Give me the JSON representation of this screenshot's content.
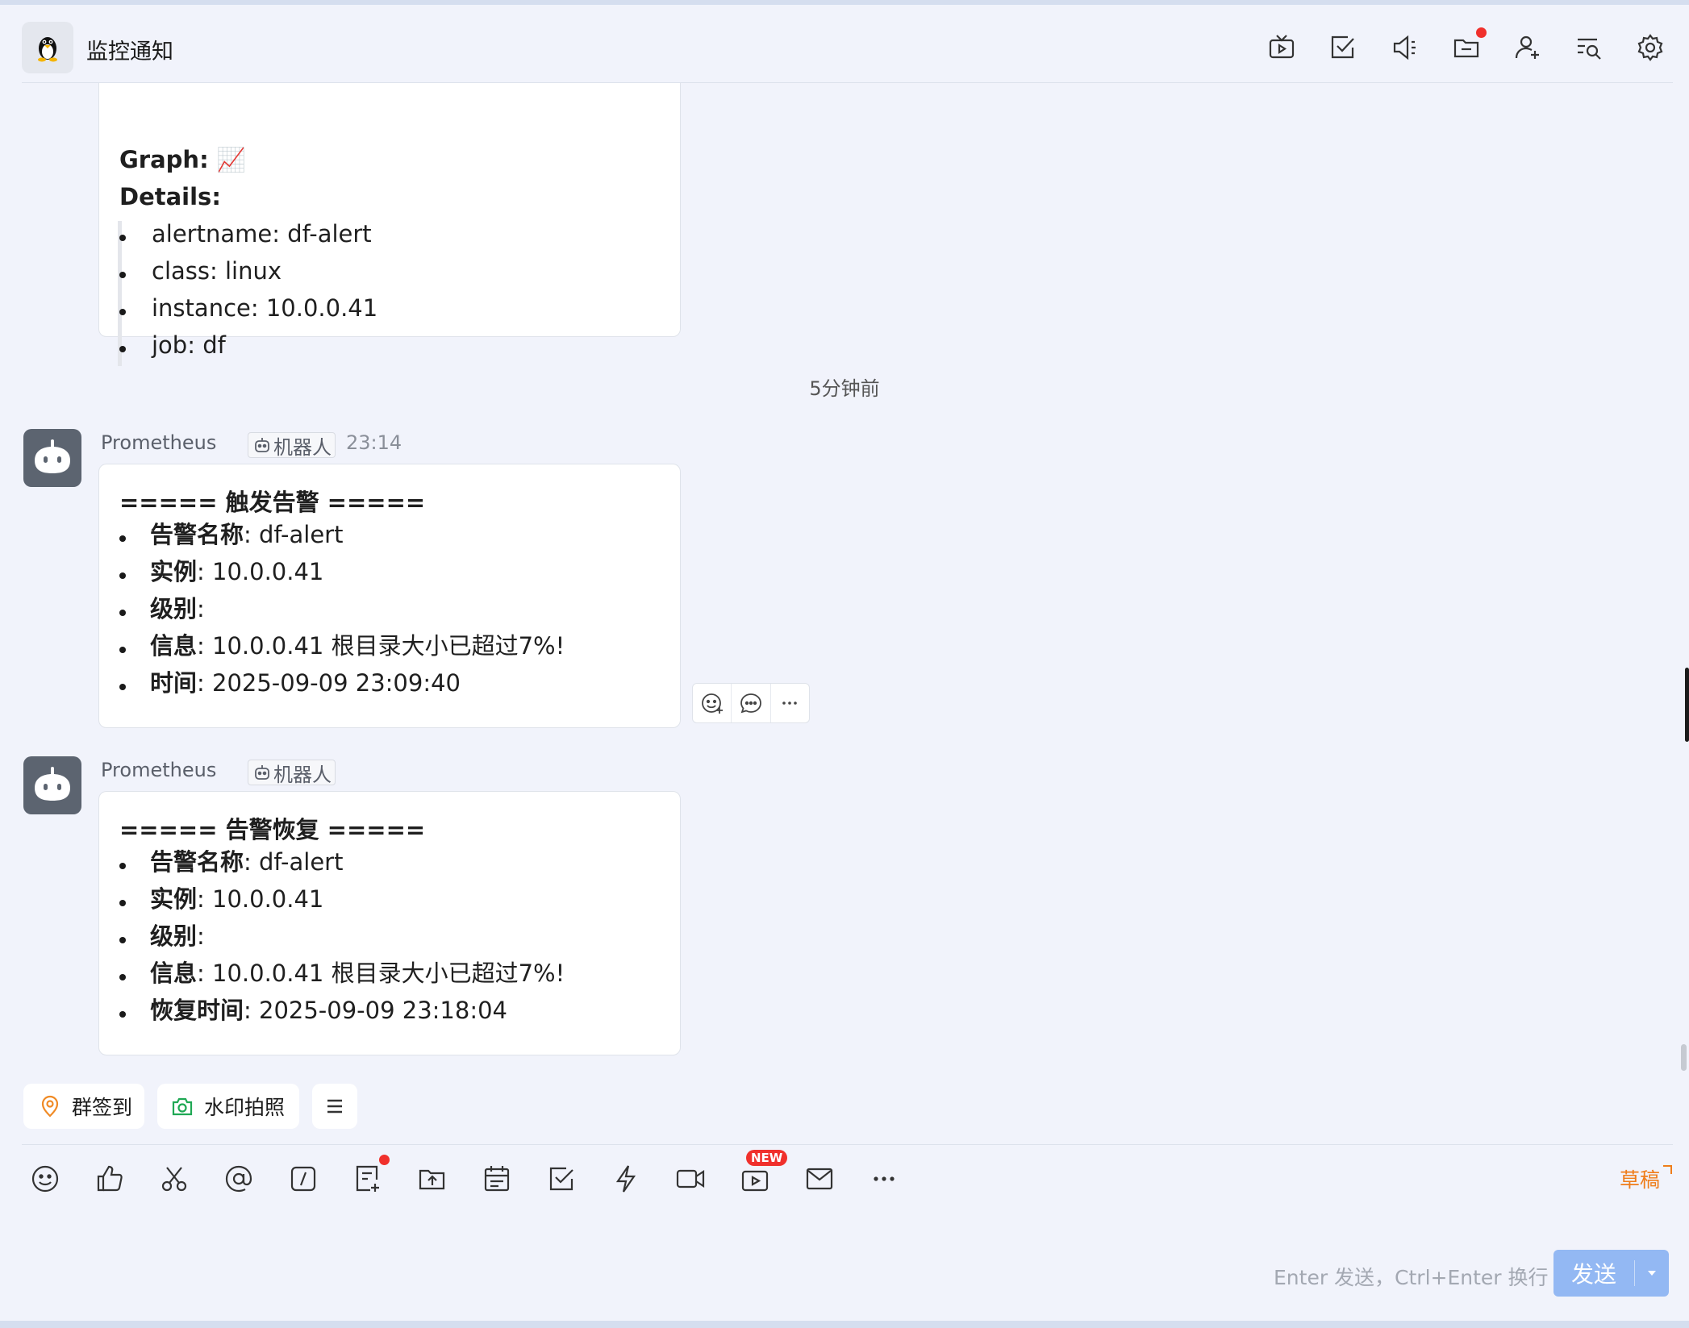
{
  "header": {
    "title": "监控通知",
    "icons": [
      "live-icon",
      "task-icon",
      "announcement-icon",
      "folder-icon",
      "add-member-icon",
      "search-history-icon",
      "settings-icon"
    ],
    "colors": {
      "notification_dot": "#f0302c"
    }
  },
  "messages": {
    "previous": {
      "graph_label": "Graph:",
      "graph_emoji": "📈",
      "details_label": "Details:",
      "details": [
        "alertname: df-alert",
        "class: linux",
        "instance: 10.0.0.41",
        "job: df"
      ]
    },
    "time_divider": "5分钟前",
    "firing": {
      "sender": "Prometheus",
      "tag": "机器人",
      "time": "23:14",
      "heading": "===== 触发告警 =====",
      "fields": [
        {
          "key": "告警名称",
          "value": ": df-alert"
        },
        {
          "key": "实例",
          "value": ": 10.0.0.41"
        },
        {
          "key": "级别",
          "value": ":"
        },
        {
          "key": "信息",
          "value": ": 10.0.0.41 根目录大小已超过7%!"
        },
        {
          "key": "时间",
          "value": ": 2025-09-09 23:09:40"
        }
      ]
    },
    "resolved": {
      "sender": "Prometheus",
      "tag": "机器人",
      "heading": "===== 告警恢复 =====",
      "fields": [
        {
          "key": "告警名称",
          "value": ": df-alert"
        },
        {
          "key": "实例",
          "value": ": 10.0.0.41"
        },
        {
          "key": "级别",
          "value": ":"
        },
        {
          "key": "信息",
          "value": ": 10.0.0.41 根目录大小已超过7%!"
        },
        {
          "key": "恢复时间",
          "value": ": 2025-09-09 23:18:04"
        }
      ]
    }
  },
  "quick_actions": {
    "checkin": "群签到",
    "watermark_photo": "水印拍照"
  },
  "toolbar": {
    "new_badge": "NEW",
    "draft": "草稿",
    "colors": {
      "draft": "#ef7d1a",
      "badge": "#f0302c"
    }
  },
  "composer": {
    "hint": "Enter 发送，Ctrl+Enter 换行",
    "send": "发送",
    "colors": {
      "send_button": "#93b8f3"
    }
  }
}
